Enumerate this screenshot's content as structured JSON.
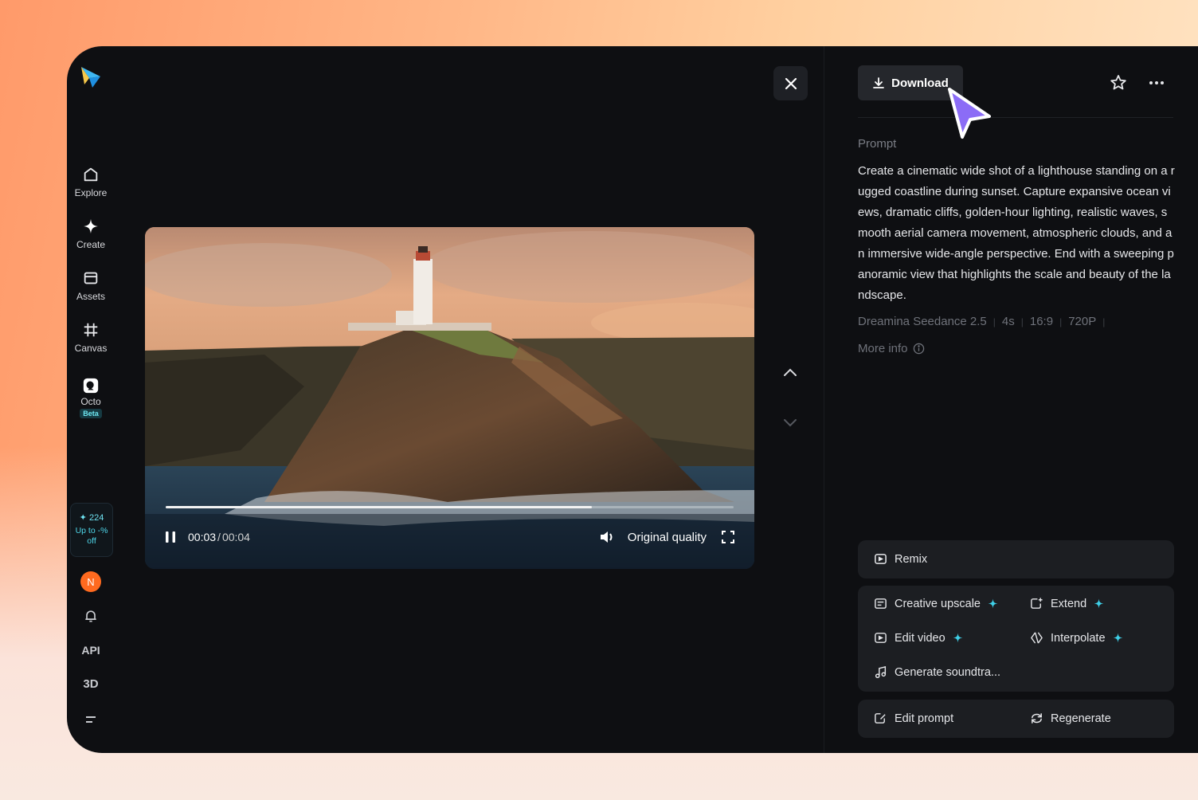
{
  "sidebar": {
    "items": [
      {
        "label": "Explore",
        "icon": "home-icon"
      },
      {
        "label": "Create",
        "icon": "sparkle-icon"
      },
      {
        "label": "Assets",
        "icon": "folder-icon"
      },
      {
        "label": "Canvas",
        "icon": "crop-grid-icon"
      },
      {
        "label": "Octo",
        "icon": "octo-icon",
        "badge": "Beta"
      }
    ],
    "credits": {
      "count": "224",
      "promo_line1": "Up to -%",
      "promo_line2": "off"
    },
    "avatar_letter": "N",
    "api_label": "API",
    "three_d_label": "3D"
  },
  "player": {
    "current_time": "00:03",
    "separator": "/",
    "total_time": "00:04",
    "progress_fraction": 0.75,
    "quality_label": "Original quality"
  },
  "panel": {
    "download_label": "Download",
    "prompt_label": "Prompt",
    "prompt_text": "Create a cinematic wide shot of a lighthouse standing on a rugged coastline during sunset. Capture expansive ocean views, dramatic cliffs, golden-hour lighting, realistic waves, smooth aerial camera movement, atmospheric clouds, and an immersive wide-angle perspective. End with a sweeping panoramic view that highlights the scale and beauty of the landscape.",
    "meta": [
      "Dreamina Seedance 2.5",
      "4s",
      "16:9",
      "720P"
    ],
    "more_info": "More info",
    "actions": {
      "remix": "Remix",
      "creative_upscale": "Creative upscale",
      "extend": "Extend",
      "edit_video": "Edit video",
      "interpolate": "Interpolate",
      "generate_soundtrack": "Generate soundtra...",
      "edit_prompt": "Edit prompt",
      "regenerate": "Regenerate"
    }
  },
  "colors": {
    "accent": "#3fd0e8",
    "cursor": "#8b6cf6",
    "avatar": "#ff6a1f"
  }
}
